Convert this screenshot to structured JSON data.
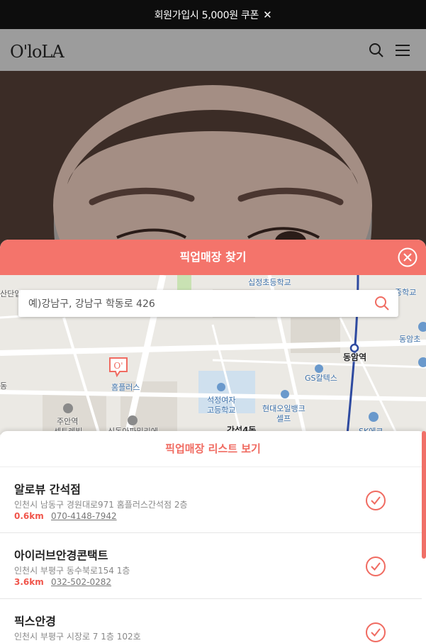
{
  "promo_bar": {
    "text": "회원가입시 5,000원 쿠폰",
    "close_glyph": "✕"
  },
  "header": {
    "logo": "O'loLA",
    "search_icon": "search-icon",
    "menu_icon": "hamburger-menu-icon"
  },
  "pickup_panel": {
    "title": "픽업매장 찾기",
    "close_icon": "close-circle-icon",
    "accent_color": "#f4746b",
    "search": {
      "placeholder": "예)강남구, 강남구 학동로 426",
      "value": ""
    },
    "map_labels": {
      "school1": "십정초등학교",
      "station": "동암역",
      "gs": "GS칼텍스",
      "homeplus": "홈플러스",
      "school2_line1": "석정여자",
      "school2_line2": "고등학교",
      "oil_line1": "현대오일뱅크",
      "oil_line2": "셀프",
      "juan_line1": "주안역",
      "juan_line2": "센트레빌",
      "district": "간석4동",
      "sk": "SK에코",
      "sandan": "산단입",
      "middle": "중학교",
      "dongam_middle": "동암초",
      "left_edge": "동",
      "sinui": "신동아파밀리에"
    },
    "list_title": "픽업매장 리스트 보기",
    "stores": [
      {
        "name": "알로뷰 간석점",
        "address": "인천시 남동구 경원대로971 홈플러스간석점 2층",
        "distance": "0.6km",
        "phone": "070-4148-7942"
      },
      {
        "name": "아이러브안경콘택트",
        "address": "인천시 부평구 동수북로154 1층",
        "distance": "3.6km",
        "phone": "032-502-0282"
      },
      {
        "name": "픽스안경",
        "address": "인천시 부평구 시장로 7 1층 102호",
        "distance": "",
        "phone": ""
      }
    ]
  }
}
